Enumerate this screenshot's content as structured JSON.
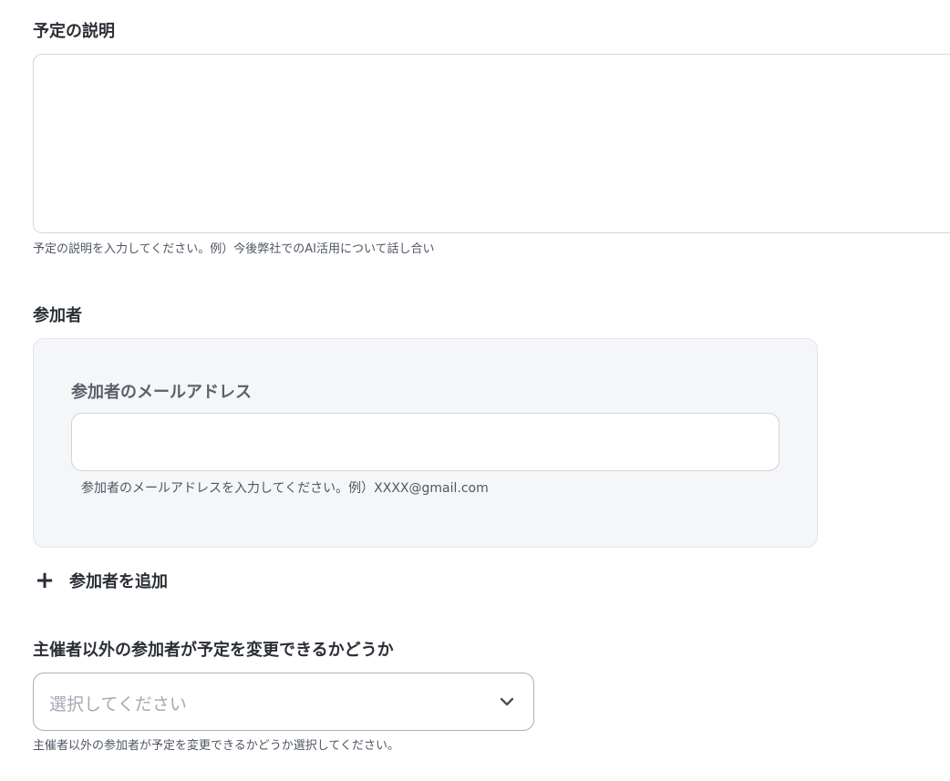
{
  "description": {
    "label": "予定の説明",
    "value": "",
    "hint": "予定の説明を入力してください。例）今後弊社でのAI活用について話し合い"
  },
  "participants": {
    "label": "参加者",
    "email_label": "参加者のメールアドレス",
    "email_value": "",
    "email_hint": "参加者のメールアドレスを入力してください。例）XXXX@gmail.com",
    "add_label": "参加者を追加",
    "add_icon": "plus-icon"
  },
  "guests_can_modify": {
    "label": "主催者以外の参加者が予定を変更できるかどうか",
    "placeholder": "選択してください",
    "chevron_icon": "chevron-down-icon",
    "hint": "主催者以外の参加者が予定を変更できるかどうか選択してください。"
  }
}
